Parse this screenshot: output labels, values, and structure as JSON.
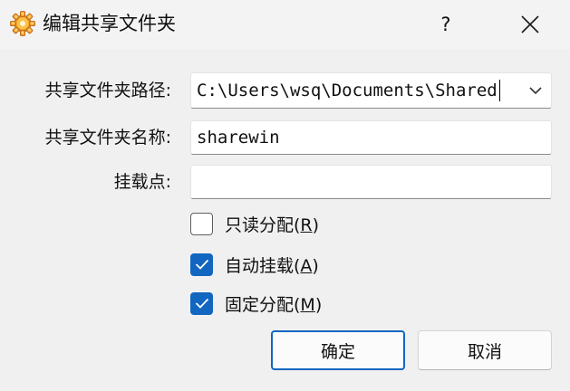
{
  "window": {
    "title": "编辑共享文件夹",
    "help_label": "?",
    "icon": "gear-app-icon",
    "close_icon": "close-icon"
  },
  "form": {
    "path_label": "共享文件夹路径:",
    "path_value": "C:\\Users\\wsq\\Documents\\Shared",
    "name_label": "共享文件夹名称:",
    "name_value": "sharewin",
    "mount_label": "挂载点:",
    "mount_value": ""
  },
  "options": [
    {
      "label": "只读分配(",
      "key": "R",
      "suffix": ")",
      "checked": false
    },
    {
      "label": "自动挂载(",
      "key": "A",
      "suffix": ")",
      "checked": true
    },
    {
      "label": "固定分配(",
      "key": "M",
      "suffix": ")",
      "checked": true
    }
  ],
  "buttons": {
    "ok": "确定",
    "cancel": "取消"
  },
  "colors": {
    "accent": "#1266c0",
    "background": "#f0f0f0"
  }
}
